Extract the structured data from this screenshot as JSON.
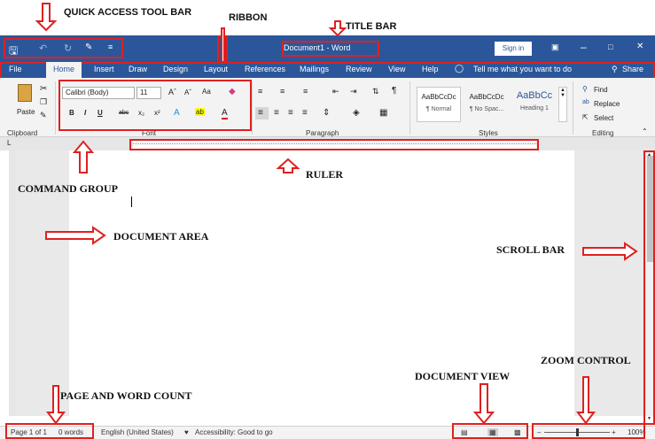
{
  "annotations": {
    "quick_access_toolbar": "QUICK ACCESS TOOL BAR",
    "ribbon": "RIBBON",
    "title_bar": "TITLE BAR",
    "command_group": "COMMAND GROUP",
    "ruler": "RULER",
    "document_area": "DOCUMENT AREA",
    "scroll_bar": "SCROLL BAR",
    "zoom_control": "ZOOM CONTROL",
    "document_view": "DOCUMENT VIEW",
    "page_word_count": "PAGE AND WORD COUNT"
  },
  "title_bar": {
    "title": "Document1  -  Word",
    "sign_in": "Sign in"
  },
  "tabs": [
    "File",
    "Home",
    "Insert",
    "Draw",
    "Design",
    "Layout",
    "References",
    "Mailings",
    "Review",
    "View",
    "Help"
  ],
  "tell_me": "Tell me what you want to do",
  "share": "Share",
  "clipboard": {
    "paste": "Paste",
    "label": "Clipboard"
  },
  "font": {
    "name": "Calibri (Body)",
    "size": "11",
    "label": "Font",
    "aa": "Aa"
  },
  "paragraph": {
    "label": "Paragraph"
  },
  "styles": {
    "label": "Styles",
    "items": [
      {
        "preview": "AaBbCcDc",
        "name": "¶ Normal"
      },
      {
        "preview": "AaBbCcDc",
        "name": "¶ No Spac..."
      },
      {
        "preview": "AaBbCc",
        "name": "Heading 1"
      }
    ]
  },
  "editing": {
    "label": "Editing",
    "find": "Find",
    "replace": "Replace",
    "select": "Select"
  },
  "status": {
    "page": "Page 1 of 1",
    "words": "0 words",
    "language": "English (United States)",
    "accessibility": "Accessibility: Good to go",
    "zoom": "100%"
  },
  "colors": {
    "word_blue": "#2b579a",
    "annotation_red": "#e02020"
  }
}
